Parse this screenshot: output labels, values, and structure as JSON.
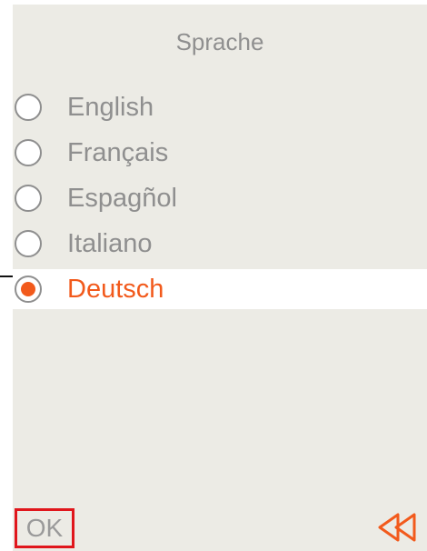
{
  "header": {
    "title": "Sprache"
  },
  "languages": [
    {
      "label": "English",
      "selected": false
    },
    {
      "label": "Français",
      "selected": false
    },
    {
      "label": "Espagñol",
      "selected": false
    },
    {
      "label": "Italiano",
      "selected": false
    },
    {
      "label": "Deutsch",
      "selected": true
    }
  ],
  "footer": {
    "ok_label": "OK",
    "back_icon": "double-chevron-left-icon"
  },
  "colors": {
    "background": "#ecebe5",
    "accent": "#f25a1c",
    "text": "#8f8f8f",
    "ok_border": "#e0161c"
  }
}
